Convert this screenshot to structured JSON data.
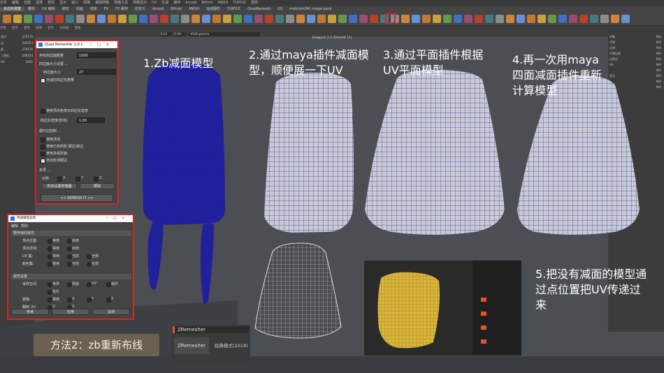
{
  "menu": {
    "items": [
      "文件",
      "编辑",
      "创建",
      "选择",
      "修改",
      "显示",
      "窗口",
      "网格",
      "编辑网格",
      "网格工具",
      "网格显示",
      "UV",
      "生成",
      "缓存",
      "Arnold",
      "Bifrost",
      "MASH",
      "TURTLE",
      "帮助"
    ]
  },
  "tabs": {
    "items": [
      "多边形建模",
      "雕刻",
      "UV 编辑",
      "绑定",
      "动画",
      "渲染",
      "FX",
      "FX 缓存",
      "自定义",
      "Arnold",
      "Bifrost",
      "MASH",
      "运动图形",
      "TURTLE",
      "QuadRemesh",
      "GS",
      "malcolm341 mega pack"
    ],
    "active": 0
  },
  "statusrow": {
    "items": [
      "对象",
      "显示",
      "着色",
      "照明",
      "显示",
      "渲染器",
      "面板"
    ]
  },
  "viewport": {
    "field_values": [
      "0.00",
      "1.00"
    ],
    "color_space": "sRGB gamma",
    "title": "Viewport 2.0 (DirectX 11)"
  },
  "left_channel": {
    "rows": [
      {
        "label": "顶点",
        "value": "270176"
      },
      {
        "label": "边",
        "value": "540354"
      },
      {
        "label": "面",
        "value": "270176"
      },
      {
        "label": "三角形",
        "value": "540354"
      },
      {
        "label": "UV",
        "value": "3421"
      }
    ]
  },
  "right_panel": {
    "rows": [
      {
        "label": "对象",
        "value": "N/A"
      },
      {
        "label": "平滑",
        "value": "N/A"
      },
      {
        "label": "比例",
        "value": "N/A"
      },
      {
        "label": "平滑比例",
        "value": "N/A"
      },
      {
        "label": "边界边",
        "value": "N/A"
      },
      {
        "label": "UV",
        "value": "N/A"
      },
      {
        "label": "",
        "value": "N/A"
      },
      {
        "label": "显示",
        "value": "N/A"
      },
      {
        "label": "",
        "value": "N/A"
      },
      {
        "label": "",
        "value": "N/A"
      }
    ]
  },
  "quad_remesher": {
    "title": "Quad Remesher 1.0.1",
    "target_label": "目标四边面数量",
    "target_value": "1000",
    "adaptive_label": "四边面大小设置 ...",
    "adaptive_size_label": "四边面大小",
    "adaptive_value": "27",
    "adapt_quad_count_label": "自适应四边化数量",
    "use_vertex_color_label": "使用顶点色表示四边化密度",
    "density_label": "四边化密度(影响)",
    "density_value": "1.00",
    "loops_label": "循环边控制 ...",
    "use_normals_label": "使用法线",
    "use_materials_label": "使用已有的软 硬边/缝边",
    "use_smoothing_label": "使用多组折面",
    "detect_hard_label": "自动检测硬边",
    "misc_label": "杂项 ...",
    "symmetry_label": "对称",
    "axes": [
      "X",
      "Y",
      "Z"
    ],
    "presets_button": "形状设置管理器",
    "help_button": "帮助",
    "remesh_button": "<<   REMESH IT   >>"
  },
  "transfer_dialog": {
    "title": "传递属性选项",
    "menu": [
      "编辑",
      "帮助"
    ],
    "section1": "要传递的属性",
    "rows1": [
      {
        "label": "顶点位置:",
        "opts": [
          "禁用",
          "启用"
        ]
      },
      {
        "label": "顶点法线:",
        "opts": [
          "禁用",
          "启用"
        ]
      },
      {
        "label": "UV 集:",
        "opts": [
          "禁用",
          "当前",
          "全部"
        ]
      },
      {
        "label": "颜色集:",
        "opts": [
          "禁用",
          "当前",
          "全部"
        ]
      }
    ],
    "section2": "属性设置",
    "rows2": [
      {
        "label": "采样空间:",
        "opts": [
          "世界",
          "局部",
          "UV",
          "组件"
        ]
      },
      {
        "label": "",
        "opts": [
          "拓扑"
        ]
      },
      {
        "label": "镜像:",
        "opts": [
          "禁用",
          "X",
          "Y",
          "Z"
        ]
      },
      {
        "label": "翻转 UV:",
        "opts": [
          "U",
          "V"
        ]
      }
    ],
    "buttons": [
      "传递",
      "应用",
      "关闭"
    ]
  },
  "annotations": {
    "step1": "1.Zb减面模型",
    "step2": "2.通过maya插件减面模型，顺便展一下UV",
    "step3": "3.通过平面插件根据UV平面模型",
    "step4": "4.再一次用maya四面减面插件重新计算模型",
    "step5": "5.把没有减面的模型通过点位置把UV传递过来",
    "method": "方法2：zb重新布线"
  },
  "zremesher": {
    "title": "ZRemesher",
    "button": "ZRemesher",
    "mode": "经典模式(2018)"
  },
  "colors": {
    "accent_red": "#d22222",
    "mesh_blue": "#1a1a8c",
    "mesh_wire": "#3a3a8a",
    "mesh_fill": "#c8cbd6",
    "uv_yellow": "#d8b43a"
  }
}
